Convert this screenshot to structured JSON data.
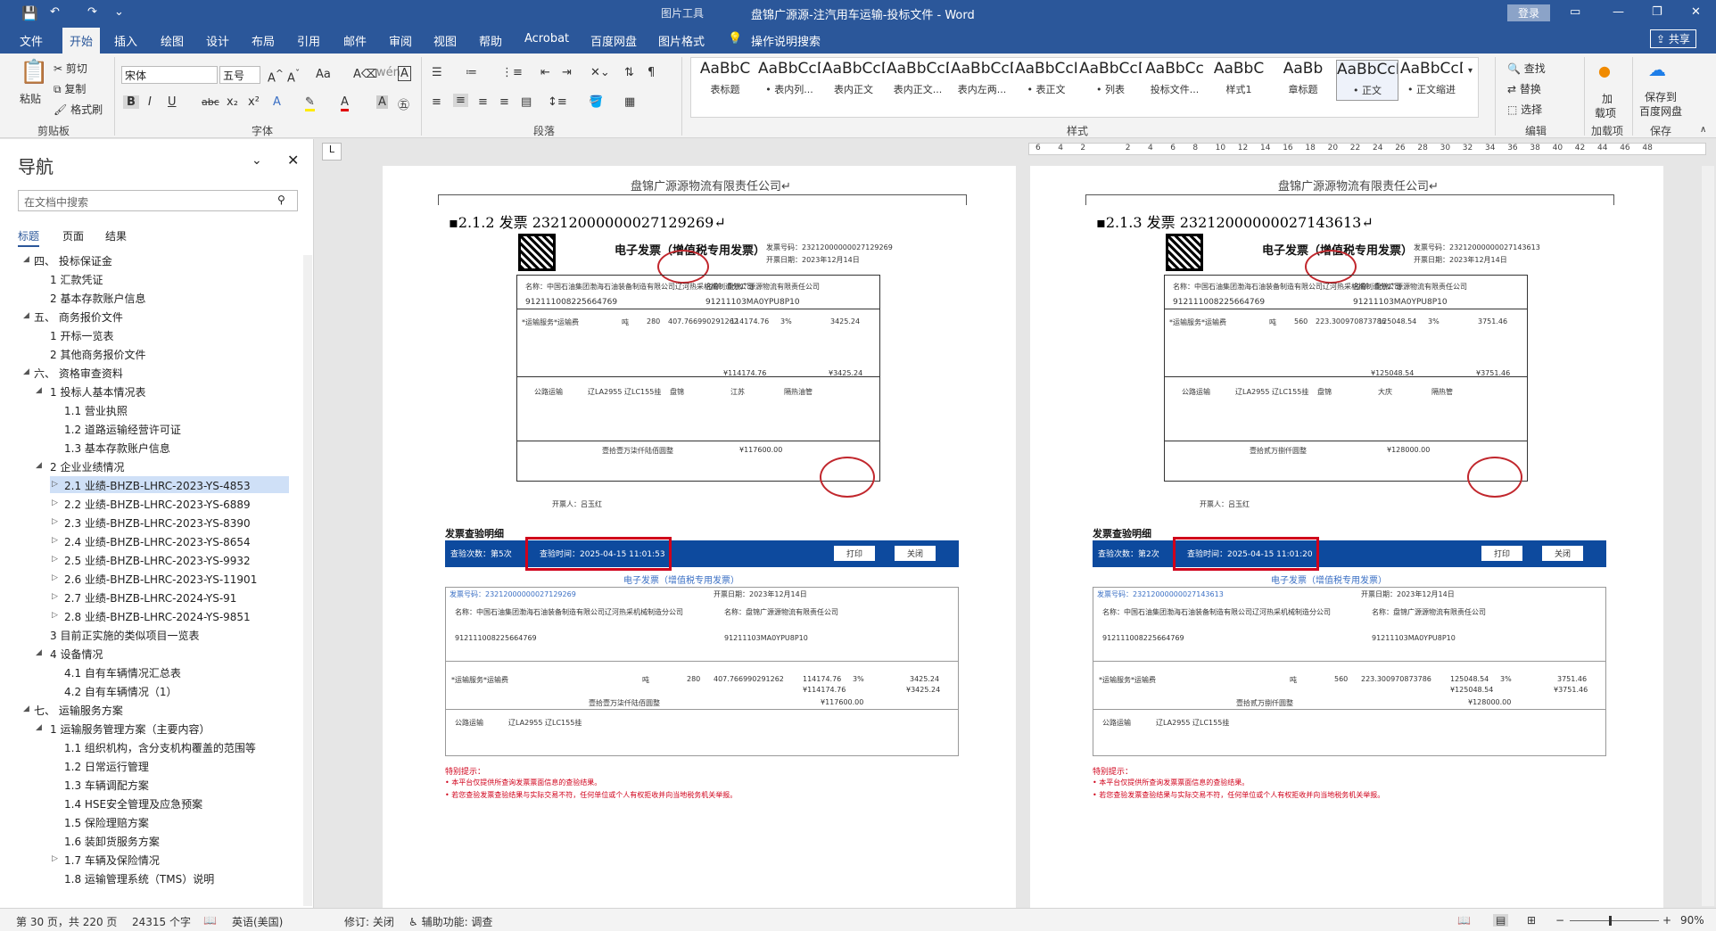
{
  "window": {
    "title": "盘锦广源源-注汽用车运输-投标文件  -  Word",
    "context_tab": "图片工具",
    "login": "登录"
  },
  "tabs": [
    "文件",
    "开始",
    "插入",
    "绘图",
    "设计",
    "布局",
    "引用",
    "邮件",
    "审阅",
    "视图",
    "帮助",
    "Acrobat",
    "百度网盘",
    "图片格式"
  ],
  "tell_me": "操作说明搜索",
  "share": "共享",
  "ribbon": {
    "clipboard": {
      "paste": "粘贴",
      "cut": "剪切",
      "copy": "复制",
      "format_painter": "格式刷",
      "group": "剪贴板"
    },
    "font": {
      "name": "宋体",
      "size": "五号",
      "group": "字体"
    },
    "paragraph": {
      "group": "段落"
    },
    "styles": {
      "group": "样式",
      "items": [
        {
          "sample": "AaBbC",
          "label": "表标题"
        },
        {
          "sample": "AaBbCcD",
          "label": "• 表内列..."
        },
        {
          "sample": "AaBbCcDd",
          "label": "表内正文"
        },
        {
          "sample": "AaBbCcDd",
          "label": "表内正文..."
        },
        {
          "sample": "AaBbCcDdEc",
          "label": "表内左两..."
        },
        {
          "sample": "AaBbCcI",
          "label": "• 表正文"
        },
        {
          "sample": "AaBbCcDc",
          "label": "• 列表"
        },
        {
          "sample": "AaBbCc",
          "label": "投标文件..."
        },
        {
          "sample": "AaBbC",
          "label": "样式1"
        },
        {
          "sample": "AaBb",
          "label": "章标题"
        },
        {
          "sample": "AaBbCcDd",
          "label": "• 正文"
        },
        {
          "sample": "AaBbCcDd",
          "label": "• 正文缩进"
        }
      ]
    },
    "editing": {
      "find": "查找",
      "replace": "替换",
      "select": "选择",
      "group": "编辑"
    },
    "addins": {
      "label1": "加",
      "label2": "载项",
      "group": "加载项"
    },
    "baidu": {
      "label1": "保存到",
      "label2": "百度网盘",
      "group": "保存"
    }
  },
  "nav": {
    "title": "导航",
    "search_placeholder": "在文档中搜索",
    "tabs": [
      "标题",
      "页面",
      "结果"
    ],
    "items": [
      {
        "text": "四、 投标保证金",
        "level": 1,
        "tri": "◢"
      },
      {
        "text": "1 汇款凭证",
        "level": 2,
        "tri": ""
      },
      {
        "text": "2 基本存款账户信息",
        "level": 2,
        "tri": ""
      },
      {
        "text": "五、 商务报价文件",
        "level": 1,
        "tri": "◢"
      },
      {
        "text": "1 开标一览表",
        "level": 2,
        "tri": ""
      },
      {
        "text": "2 其他商务报价文件",
        "level": 2,
        "tri": ""
      },
      {
        "text": "六、 资格审查资料",
        "level": 1,
        "tri": "◢"
      },
      {
        "text": "1 投标人基本情况表",
        "level": 2,
        "tri": "◢"
      },
      {
        "text": "1.1 营业执照",
        "level": 3,
        "tri": ""
      },
      {
        "text": "1.2 道路运输经营许可证",
        "level": 3,
        "tri": ""
      },
      {
        "text": "1.3 基本存款账户信息",
        "level": 3,
        "tri": ""
      },
      {
        "text": "2 企业业绩情况",
        "level": 2,
        "tri": "◢"
      },
      {
        "text": "2.1 业绩-BHZB-LHRC-2023-YS-4853",
        "level": 3,
        "tri": "▷",
        "selected": true
      },
      {
        "text": "2.2 业绩-BHZB-LHRC-2023-YS-6889",
        "level": 3,
        "tri": "▷"
      },
      {
        "text": "2.3 业绩-BHZB-LHRC-2023-YS-8390",
        "level": 3,
        "tri": "▷"
      },
      {
        "text": "2.4 业绩-BHZB-LHRC-2023-YS-8654",
        "level": 3,
        "tri": "▷"
      },
      {
        "text": "2.5 业绩-BHZB-LHRC-2023-YS-9932",
        "level": 3,
        "tri": "▷"
      },
      {
        "text": "2.6 业绩-BHZB-LHRC-2023-YS-11901",
        "level": 3,
        "tri": "▷"
      },
      {
        "text": "2.7 业绩-BHZB-LHRC-2024-YS-91",
        "level": 3,
        "tri": "▷"
      },
      {
        "text": "2.8 业绩-BHZB-LHRC-2024-YS-9851",
        "level": 3,
        "tri": "▷"
      },
      {
        "text": "3 目前正实施的类似项目一览表",
        "level": 2,
        "tri": ""
      },
      {
        "text": "4 设备情况",
        "level": 2,
        "tri": "◢"
      },
      {
        "text": "4.1 自有车辆情况汇总表",
        "level": 3,
        "tri": ""
      },
      {
        "text": "4.2 自有车辆情况（1）",
        "level": 3,
        "tri": ""
      },
      {
        "text": "七、 运输服务方案",
        "level": 1,
        "tri": "◢"
      },
      {
        "text": "1 运输服务管理方案（主要内容）",
        "level": 2,
        "tri": "◢"
      },
      {
        "text": "1.1 组织机构，含分支机构覆盖的范围等",
        "level": 3,
        "tri": ""
      },
      {
        "text": "1.2 日常运行管理",
        "level": 3,
        "tri": ""
      },
      {
        "text": "1.3 车辆调配方案",
        "level": 3,
        "tri": ""
      },
      {
        "text": "1.4 HSE安全管理及应急预案",
        "level": 3,
        "tri": ""
      },
      {
        "text": "1.5 保险理赔方案",
        "level": 3,
        "tri": ""
      },
      {
        "text": "1.6 装卸货服务方案",
        "level": 3,
        "tri": ""
      },
      {
        "text": "1.7 车辆及保险情况",
        "level": 3,
        "tri": "▷"
      },
      {
        "text": "1.8 运输管理系统（TMS）说明",
        "level": 3,
        "tri": ""
      }
    ]
  },
  "ruler": [
    "6",
    "4",
    "2",
    "",
    "2",
    "4",
    "6",
    "8",
    "10",
    "12",
    "14",
    "16",
    "18",
    "20",
    "22",
    "24",
    "26",
    "28",
    "30",
    "32",
    "34",
    "36",
    "38",
    "40",
    "42",
    "44",
    "46",
    "48"
  ],
  "pages": [
    {
      "header": "盘锦广源源物流有限责任公司↵",
      "heading": "▪2.1.2 发票 23212000000027129269↵",
      "invoice_title": "电子发票（增值税专用发票）",
      "invoice_no": "发票号码：23212000000027129269",
      "invoice_date": "开票日期：2023年12月14日",
      "buyer": "名称：中国石油集团渤海石油装备制造有限公司辽河热采机械制造分公司",
      "buyer_tax": "912111008225664769",
      "seller": "名称：盘锦广源源物流有限责任公司",
      "seller_tax": "91211103MA0YPU8P10",
      "item": "*运输服务*运输费",
      "unit": "吨",
      "qty": "280",
      "price": "407.766990291262",
      "amount": "114174.76",
      "rate": "3%",
      "tax": "3425.24",
      "sum_amount": "¥114174.76",
      "sum_tax": "¥3425.24",
      "total_words": "壹拾壹万柒仟陆佰圆整",
      "total": "¥117600.00",
      "vehicle": "辽LA2955 辽LC155挂",
      "from": "盘锦",
      "to": "江苏",
      "goods": "隔热油管",
      "transport": "公路运输",
      "drawer": "开票人：吕玉红",
      "check_title": "发票查验明细",
      "check_count": "查验次数：第5次",
      "check_time": "查验时间：2025-04-15 11:01:53",
      "print": "打印",
      "close": "关闭",
      "check_invoice_title": "电子发票（增值税专用发票）",
      "note_title": "特别提示：",
      "note1": "• 本平台仅提供所查询发票票面信息的查验结果。",
      "note2": "• 若您查验发票查验结果与实际交易不符，任何单位或个人有权拒收并向当地税务机关举报。"
    },
    {
      "header": "盘锦广源源物流有限责任公司↵",
      "heading": "▪2.1.3 发票 23212000000027143613↵",
      "invoice_title": "电子发票（增值税专用发票）",
      "invoice_no": "发票号码：23212000000027143613",
      "invoice_date": "开票日期：2023年12月14日",
      "buyer": "名称：中国石油集团渤海石油装备制造有限公司辽河热采机械制造分公司",
      "buyer_tax": "912111008225664769",
      "seller": "名称：盘锦广源源物流有限责任公司",
      "seller_tax": "91211103MA0YPU8P10",
      "item": "*运输服务*运输费",
      "unit": "吨",
      "qty": "560",
      "price": "223.300970873786",
      "amount": "125048.54",
      "rate": "3%",
      "tax": "3751.46",
      "sum_amount": "¥125048.54",
      "sum_tax": "¥3751.46",
      "total_words": "壹拾贰万捌仟圆整",
      "total": "¥128000.00",
      "vehicle": "辽LA2955 辽LC155挂",
      "from": "盘锦",
      "to": "大庆",
      "goods": "隔热管",
      "transport": "公路运输",
      "drawer": "开票人：吕玉红",
      "check_title": "发票查验明细",
      "check_count": "查验次数：第2次",
      "check_time": "查验时间：2025-04-15 11:01:20",
      "print": "打印",
      "close": "关闭",
      "check_invoice_title": "电子发票（增值税专用发票）",
      "note_title": "特别提示：",
      "note1": "• 本平台仅提供所查询发票票面信息的查验结果。",
      "note2": "• 若您查验发票查验结果与实际交易不符，任何单位或个人有权拒收并向当地税务机关举报。"
    }
  ],
  "status": {
    "page": "第 30 页，共 220 页",
    "words": "24315 个字",
    "lang": "英语(美国)",
    "track": "修订: 关闭",
    "access": "辅助功能: 调查",
    "zoom": "90%"
  }
}
